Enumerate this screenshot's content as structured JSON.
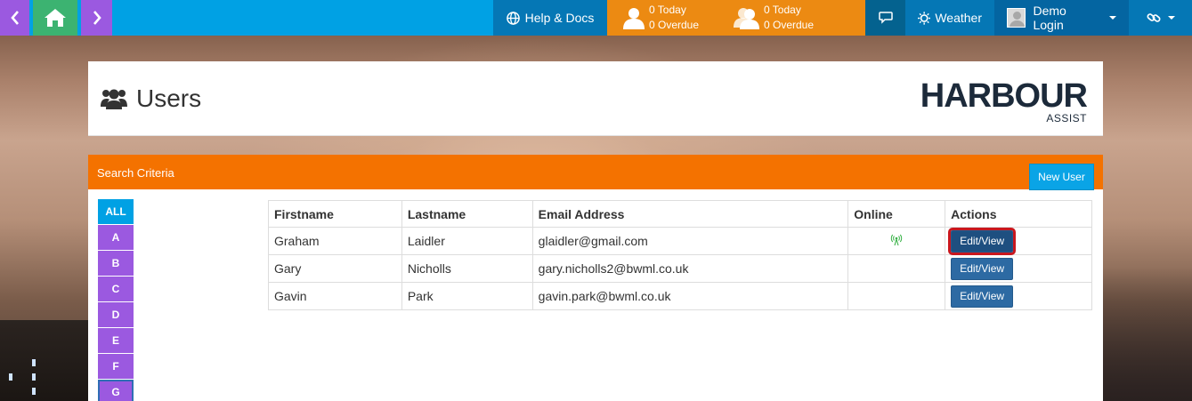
{
  "topbar": {
    "back_icon": "chevron-left-icon",
    "home_icon": "home-icon",
    "forward_icon": "chevron-right-icon",
    "help_label": "Help & Docs",
    "tasks_today": "0 Today",
    "tasks_overdue": "0 Overdue",
    "group_today": "0 Today",
    "group_overdue": "0 Overdue",
    "chat_icon": "chat-icon",
    "weather_label": "Weather",
    "user_label": "Demo Login",
    "links_icon": "link-icon"
  },
  "header": {
    "title": "Users",
    "logo_main": "HARBOUR",
    "logo_sub": "ASSIST"
  },
  "search": {
    "title": "Search Criteria",
    "new_user_label": "New User",
    "letters": [
      "ALL",
      "A",
      "B",
      "C",
      "D",
      "E",
      "F",
      "G"
    ]
  },
  "table": {
    "headers": [
      "Firstname",
      "Lastname",
      "Email Address",
      "Online",
      "Actions"
    ],
    "rows": [
      {
        "first": "Graham",
        "last": "Laidler",
        "email": "glaidler@gmail.com",
        "online": true,
        "action": "Edit/View"
      },
      {
        "first": "Gary",
        "last": "Nicholls",
        "email": "gary.nicholls2@bwml.co.uk",
        "online": false,
        "action": "Edit/View"
      },
      {
        "first": "Gavin",
        "last": "Park",
        "email": "gavin.park@bwml.co.uk",
        "online": false,
        "action": "Edit/View"
      }
    ]
  },
  "colors": {
    "topbar": "#00a1e4",
    "nav_purple": "#9b59e0",
    "home_green": "#3cb371",
    "orange": "#f47200",
    "edit_button": "#2d6aa3",
    "highlight_red": "#c9171e",
    "online_green": "#3cb34a"
  }
}
